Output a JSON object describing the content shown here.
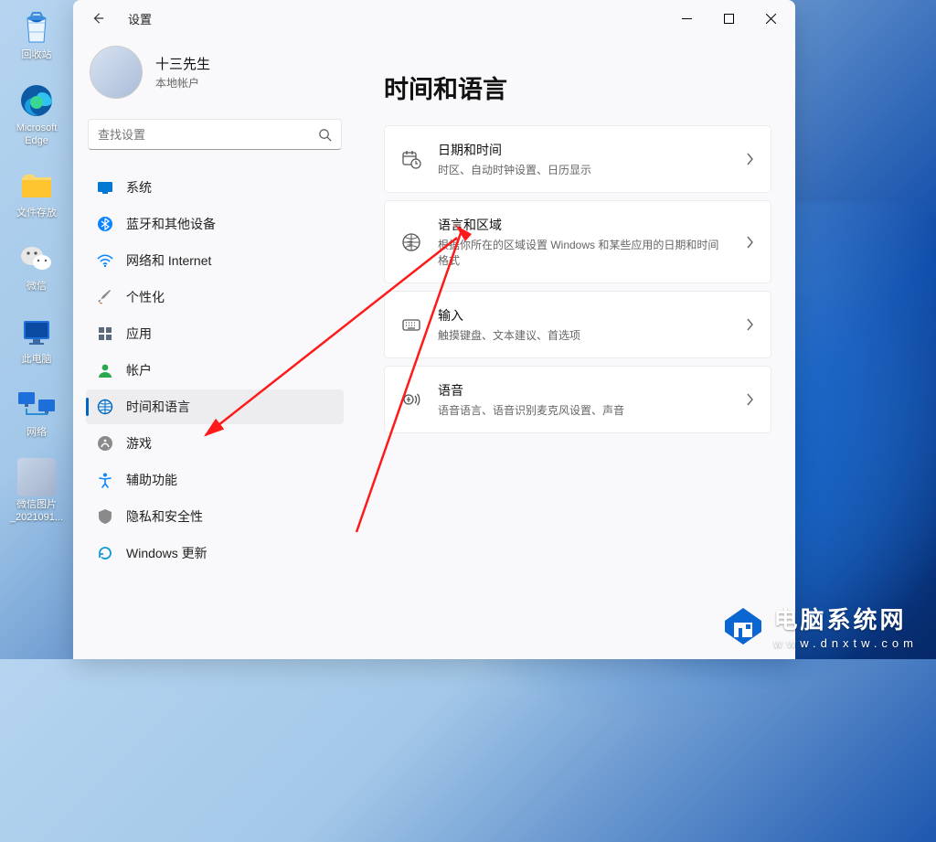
{
  "desktop": {
    "icons": [
      {
        "name": "recycle-bin",
        "label": "回收站"
      },
      {
        "name": "edge",
        "label": "Microsoft\nEdge"
      },
      {
        "name": "file-storage",
        "label": "文件存放"
      },
      {
        "name": "wechat",
        "label": "微信"
      },
      {
        "name": "this-pc",
        "label": "此电脑"
      },
      {
        "name": "network",
        "label": "网络"
      },
      {
        "name": "wechat-image",
        "label": "微信图片\n_2021091..."
      }
    ]
  },
  "window": {
    "title": "设置",
    "back_aria": "返回"
  },
  "profile": {
    "name": "十三先生",
    "account_type": "本地帐户"
  },
  "search": {
    "placeholder": "查找设置"
  },
  "nav": {
    "items": [
      {
        "key": "system",
        "label": "系统",
        "color": "#0078d4"
      },
      {
        "key": "bluetooth",
        "label": "蓝牙和其他设备",
        "color": "#0a84ff"
      },
      {
        "key": "network",
        "label": "网络和 Internet",
        "color": "#0a84ff"
      },
      {
        "key": "personalization",
        "label": "个性化",
        "color": "#8a8a8a"
      },
      {
        "key": "apps",
        "label": "应用",
        "color": "#5b6a7a"
      },
      {
        "key": "accounts",
        "label": "帐户",
        "color": "#2aa84f"
      },
      {
        "key": "time-language",
        "label": "时间和语言",
        "color": "#0067c0",
        "active": true
      },
      {
        "key": "gaming",
        "label": "游戏",
        "color": "#8a8a8a"
      },
      {
        "key": "accessibility",
        "label": "辅助功能",
        "color": "#0a84ff"
      },
      {
        "key": "privacy",
        "label": "隐私和安全性",
        "color": "#8a8a8a"
      },
      {
        "key": "update",
        "label": "Windows 更新",
        "color": "#0a9bd6"
      }
    ]
  },
  "main": {
    "heading": "时间和语言",
    "cards": [
      {
        "key": "date-time",
        "title": "日期和时间",
        "subtitle": "时区、自动时钟设置、日历显示"
      },
      {
        "key": "language-region",
        "title": "语言和区域",
        "subtitle": "根据你所在的区域设置 Windows 和某些应用的日期和时间格式"
      },
      {
        "key": "typing",
        "title": "输入",
        "subtitle": "触摸键盘、文本建议、首选项"
      },
      {
        "key": "speech",
        "title": "语音",
        "subtitle": "语音语言、语音识别麦克风设置、声音"
      }
    ]
  },
  "watermark": {
    "text_cn": "电脑系统网",
    "url": "www.dnxtw.com"
  }
}
